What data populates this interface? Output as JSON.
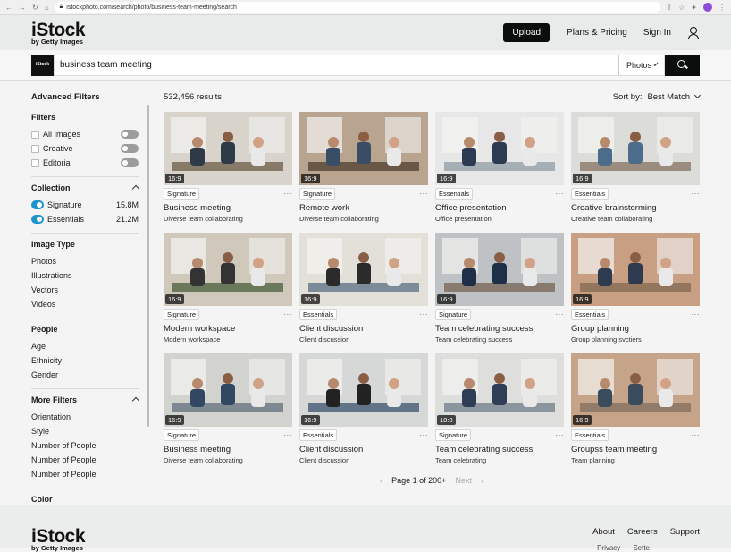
{
  "browser": {
    "url": "istockphoto.com/search/photo/business-team-meeting/search"
  },
  "header": {
    "logo_main": "iStock",
    "logo_sub": "by Getty Images",
    "upload": "Upload",
    "plans": "Plans & Pricing",
    "signin": "Sign In"
  },
  "search": {
    "logo_text": "iStock",
    "query": "business team meeting",
    "type": "Photos"
  },
  "sidebar": {
    "advanced": "Advanced Filters",
    "filters_title": "Filters",
    "filters": [
      {
        "label": "All Images"
      },
      {
        "label": "Creative"
      },
      {
        "label": "Editorial"
      }
    ],
    "collection_title": "Collection",
    "collection": [
      {
        "label": "Signature",
        "count": "15.8M"
      },
      {
        "label": "Essentials",
        "count": "21.2M"
      }
    ],
    "image_type_title": "Image Type",
    "image_types": [
      "Photos",
      "Illustrations",
      "Vectors",
      "Videos"
    ],
    "people_title": "People",
    "people": [
      "Age",
      "Ethnicity",
      "Gender"
    ],
    "more_title": "More Filters",
    "more": [
      "Orientation",
      "Style",
      "Number of People",
      "Number of People",
      "Number of People"
    ],
    "color_title": "Color"
  },
  "results": {
    "count": "532,456 results",
    "sort_label": "Sort by:",
    "sort_value": "Best Match",
    "cards": [
      {
        "ratio": "16:9",
        "badge": "Signature",
        "title": "Business meeting",
        "sub": "Diverse team collaborating"
      },
      {
        "ratio": "16:9",
        "badge": "Signature",
        "title": "Remote work",
        "sub": "Diverse team collaborating"
      },
      {
        "ratio": "16:9",
        "badge": "Essentials",
        "title": "Office presentation",
        "sub": "Office presentation"
      },
      {
        "ratio": "16:9",
        "badge": "Essentials",
        "title": "Creative brainstorming",
        "sub": "Creative team collaborating"
      },
      {
        "ratio": "16:9",
        "badge": "Signature",
        "title": "Modern workspace",
        "sub": "Modern workspace"
      },
      {
        "ratio": "16:9",
        "badge": "Essentials",
        "title": "Client discussion",
        "sub": "Client discussion"
      },
      {
        "ratio": "16:9",
        "badge": "Signature",
        "title": "Team celebrating success",
        "sub": "Team celebrating success"
      },
      {
        "ratio": "16:9",
        "badge": "Essentials",
        "title": "Group planning",
        "sub": "Group planning svctiers"
      },
      {
        "ratio": "16:9",
        "badge": "Signature",
        "title": "Business meeting",
        "sub": "Diverse team collaborating"
      },
      {
        "ratio": "16:9",
        "badge": "Essentials",
        "title": "Client discussion",
        "sub": "Client discussion"
      },
      {
        "ratio": "18:8",
        "badge": "Signature",
        "title": "Team celebrating success",
        "sub": "Team celebrating"
      },
      {
        "ratio": "16:9",
        "badge": "Essentials",
        "title": "Groupss team meeting",
        "sub": "Team planning"
      }
    ],
    "dots": "···"
  },
  "pager": {
    "page_text": "Page 1 of 200+",
    "next": "Next"
  },
  "footer": {
    "logo_main": "iStock",
    "logo_sub": "by Getty Images",
    "links": [
      "About",
      "Careers",
      "Support"
    ],
    "sublinks": [
      "Privacy",
      "Sette"
    ]
  },
  "colors": {
    "accent_toggle": "#1c93c9",
    "dark_button": "#0c0d0d",
    "avatar": "#8d4bd8"
  }
}
